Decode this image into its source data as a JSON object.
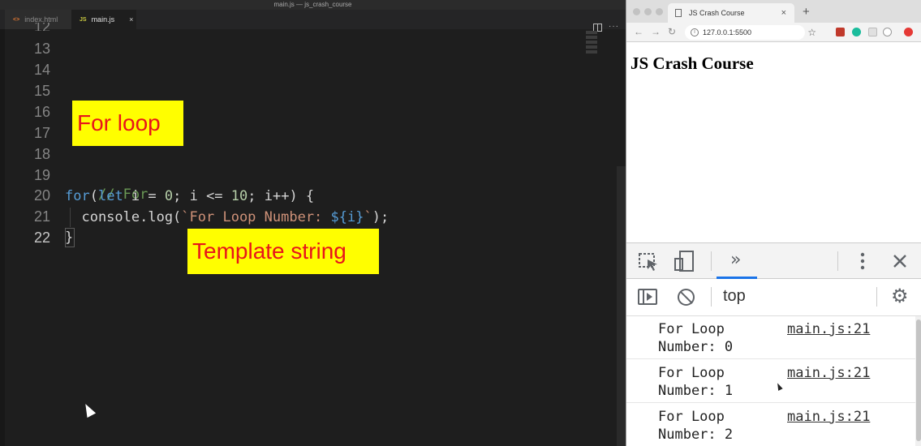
{
  "editor": {
    "window_title": "main.js — js_crash_course",
    "tabs": [
      {
        "label": "index.html",
        "icon": "html-file-icon",
        "active": false
      },
      {
        "label": "main.js",
        "icon": "js-file-icon",
        "active": true
      }
    ],
    "tab_file_glyphs": {
      "html": "<>",
      "js": "JS"
    },
    "tab_close_glyph": "×",
    "partial_line_number": "12",
    "line_numbers": [
      "13",
      "14",
      "15",
      "16",
      "17",
      "18",
      "19",
      "20",
      "21",
      "22"
    ],
    "current_line": "22",
    "code": {
      "comment": "// For",
      "line20": {
        "kw_for": "for",
        "p1": "(",
        "kw_let": "let",
        "decl": " i = ",
        "zero": "0",
        "mid": "; i <= ",
        "ten": "10",
        "tail": "; i++) {"
      },
      "line21": {
        "indent": "  console.log(",
        "str_start": "`For Loop Number: ",
        "interp": "${i}",
        "str_end": "`",
        "tail": ");"
      },
      "line22": "}"
    }
  },
  "annotations": {
    "for_loop": "For loop",
    "template_string": "Template string"
  },
  "browser": {
    "tab_title": "JS Crash Course",
    "tab_close": "×",
    "new_tab": "+",
    "url": "127.0.0.1:5500",
    "page_heading": "JS Crash Course",
    "devtools": {
      "more_tabs": "»",
      "context": "top",
      "gear": "⚙"
    },
    "console_logs": [
      {
        "message": "For Loop Number: 0",
        "source": "main.js:21"
      },
      {
        "message": "For Loop Number: 1",
        "source": "main.js:21"
      },
      {
        "message": "For Loop Number: 2",
        "source": "main.js:21"
      }
    ]
  }
}
